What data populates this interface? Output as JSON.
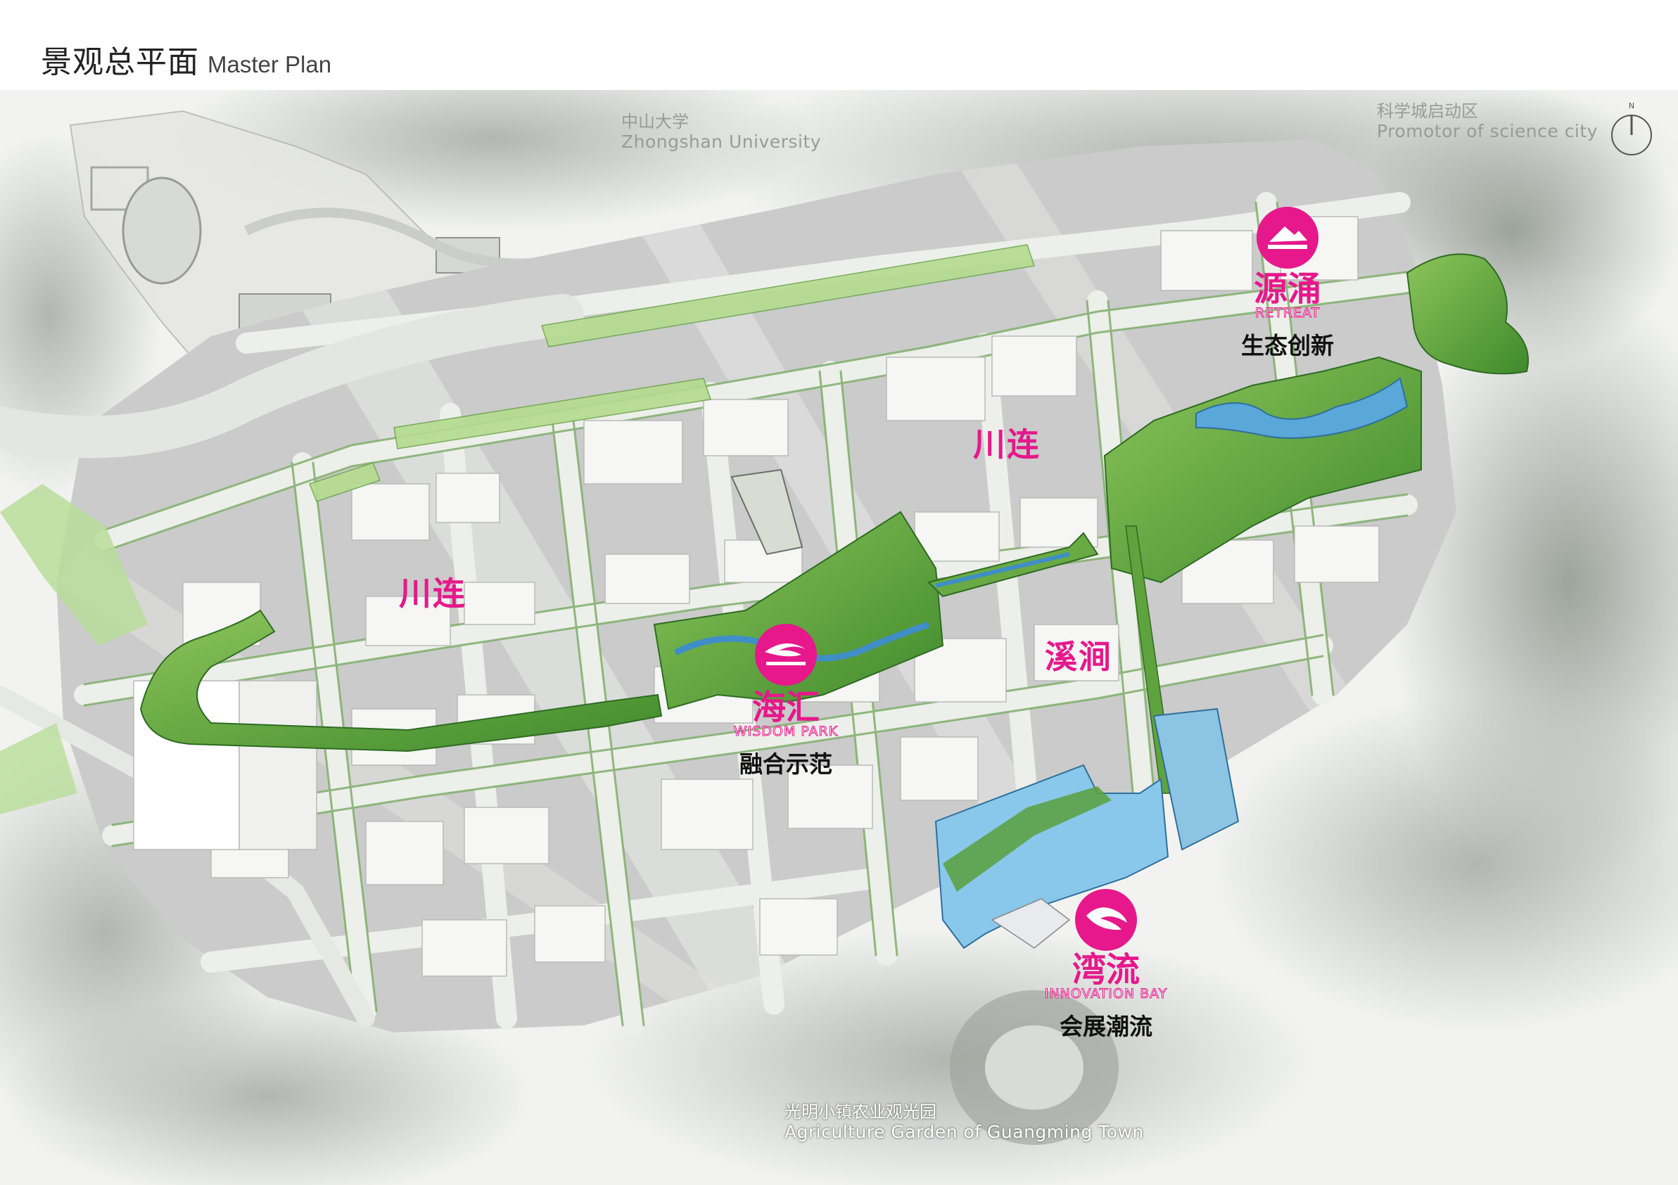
{
  "header": {
    "title_cn": "景观总平面",
    "title_en": "Master Plan"
  },
  "reference_labels": {
    "zhongshan_cn": "中山大学",
    "zhongshan_en": "Zhongshan University",
    "science_city_cn": "科学城启动区",
    "science_city_en": "Promotor of science city",
    "agri_garden_cn": "光明小镇农业观光园",
    "agri_garden_en": "Agriculture Garden of Guangming Town"
  },
  "corridor_labels": {
    "chuanlian_west": "川连",
    "chuanlian_east": "川连",
    "xijian": "溪涧"
  },
  "zones": [
    {
      "name_cn": "源涌",
      "name_en": "RETREAT",
      "subtitle": "生态创新",
      "icon": "mountain-badge-icon"
    },
    {
      "name_cn": "海汇",
      "name_en": "WISDOM PARK",
      "subtitle": "融合示范",
      "icon": "wave-badge-icon"
    },
    {
      "name_cn": "湾流",
      "name_en": "INNOVATION BAY",
      "subtitle": "会展潮流",
      "icon": "bay-badge-icon"
    }
  ],
  "compass": {
    "label": "N",
    "icon": "north-arrow-icon"
  },
  "colors": {
    "accent": "#e6188b",
    "greenway": "#5aa03c",
    "water": "#5aa7d9",
    "road": "#e8ebe6",
    "block": "#c6c8c6",
    "building": "#f4f4f4"
  }
}
